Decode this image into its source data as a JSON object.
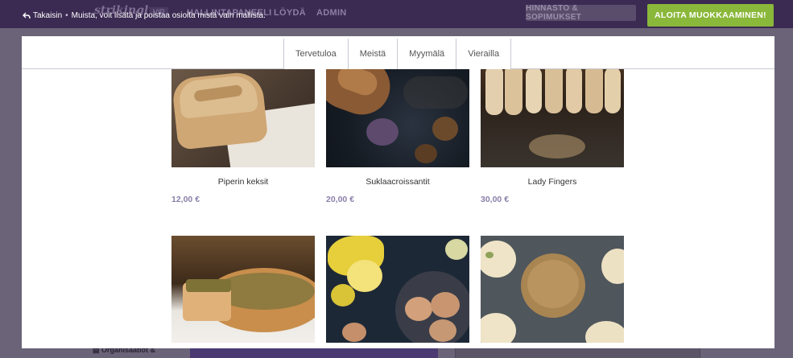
{
  "topbar": {
    "logo": "strikingly",
    "vip": "VIP",
    "nav": [
      "HALLINTAPANEELI",
      "LÖYDÄ",
      "ADMIN"
    ],
    "back_label": "Takaisin",
    "back_icon": "back-arrow-icon",
    "notice": "Muista, voit lisätä ja poistaa osioita mistä vain mallista.",
    "pricing_button": "HINNASTO & SOPIMUKSET",
    "start_button": "ALOITA MUOKKAAMINEN!"
  },
  "background": {
    "sidebar_item": "Organisaatiot &"
  },
  "preview": {
    "tabs": [
      "Tervetuloa",
      "Meistä",
      "Myymälä",
      "Vierailla"
    ],
    "products": [
      {
        "name": "Piperin keksit",
        "price": "12,00 €"
      },
      {
        "name": "Suklaacroissantit",
        "price": "20,00 €"
      },
      {
        "name": "Lady Fingers",
        "price": "30,00 €"
      },
      {
        "name": "",
        "price": ""
      },
      {
        "name": "",
        "price": ""
      },
      {
        "name": "",
        "price": ""
      }
    ]
  },
  "colors": {
    "topbar": "#3b2a52",
    "accent_green": "#8ab83a",
    "price_purple": "#8a7fa9"
  }
}
